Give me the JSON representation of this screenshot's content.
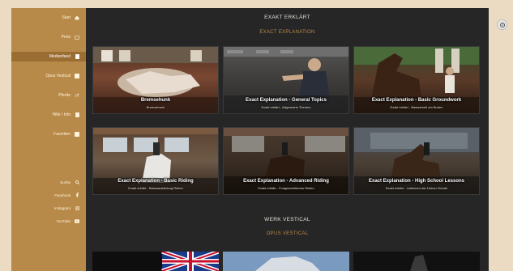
{
  "sidebar": {
    "items": [
      {
        "label": "Start",
        "icon": "home-icon"
      },
      {
        "label": "Preis",
        "icon": "tag-icon"
      },
      {
        "label": "Medienfeed",
        "icon": "feed-icon"
      },
      {
        "label": "Opus Vestical",
        "icon": "film-icon"
      },
      {
        "label": "Pferde",
        "icon": "horse-icon"
      },
      {
        "label": "Hilfe / Info",
        "icon": "info-icon"
      },
      {
        "label": "Favoriten",
        "icon": "heart-icon"
      }
    ],
    "bottom_items": [
      {
        "label": "Suche",
        "icon": "search-icon"
      },
      {
        "label": "Facebook",
        "icon": "facebook-icon"
      },
      {
        "label": "Instagram",
        "icon": "instagram-icon"
      },
      {
        "label": "YouTube",
        "icon": "youtube-icon"
      }
    ]
  },
  "section1": {
    "title": "EXAKT ERKLÄRT",
    "subtitle": "EXACT EXPLANATION"
  },
  "cards": [
    {
      "title": "Bremsehunk",
      "subtitle": "Bremsehunk"
    },
    {
      "title": "Exact Explanation - General Topics",
      "subtitle": "Exakt erklärt - Allgemeine Themen"
    },
    {
      "title": "Exact Explanation - Basic Groundwork",
      "subtitle": "Exakt erklärt - Basisarbeit am Boden"
    },
    {
      "title": "Exact Explanation - Basic Riding",
      "subtitle": "Exakt erklärt - Basisausbildung Reiten"
    },
    {
      "title": "Exact Explanation - Advanced Riding",
      "subtitle": "Exakt erklärt - Fortgeschrittenes Reiten"
    },
    {
      "title": "Exact Explanation - High School Lessons",
      "subtitle": "Exakt erklärt - Lektionen der Hohen Schule"
    }
  ],
  "section2": {
    "title": "WERK VESTICAL",
    "subtitle": "OPUS VESTICAL"
  },
  "colors": {
    "sidebar": "#b88a4a",
    "sidebar_active": "#9a6e33",
    "background": "#262626",
    "accent": "#b88a4a",
    "page": "#eadbc2"
  }
}
